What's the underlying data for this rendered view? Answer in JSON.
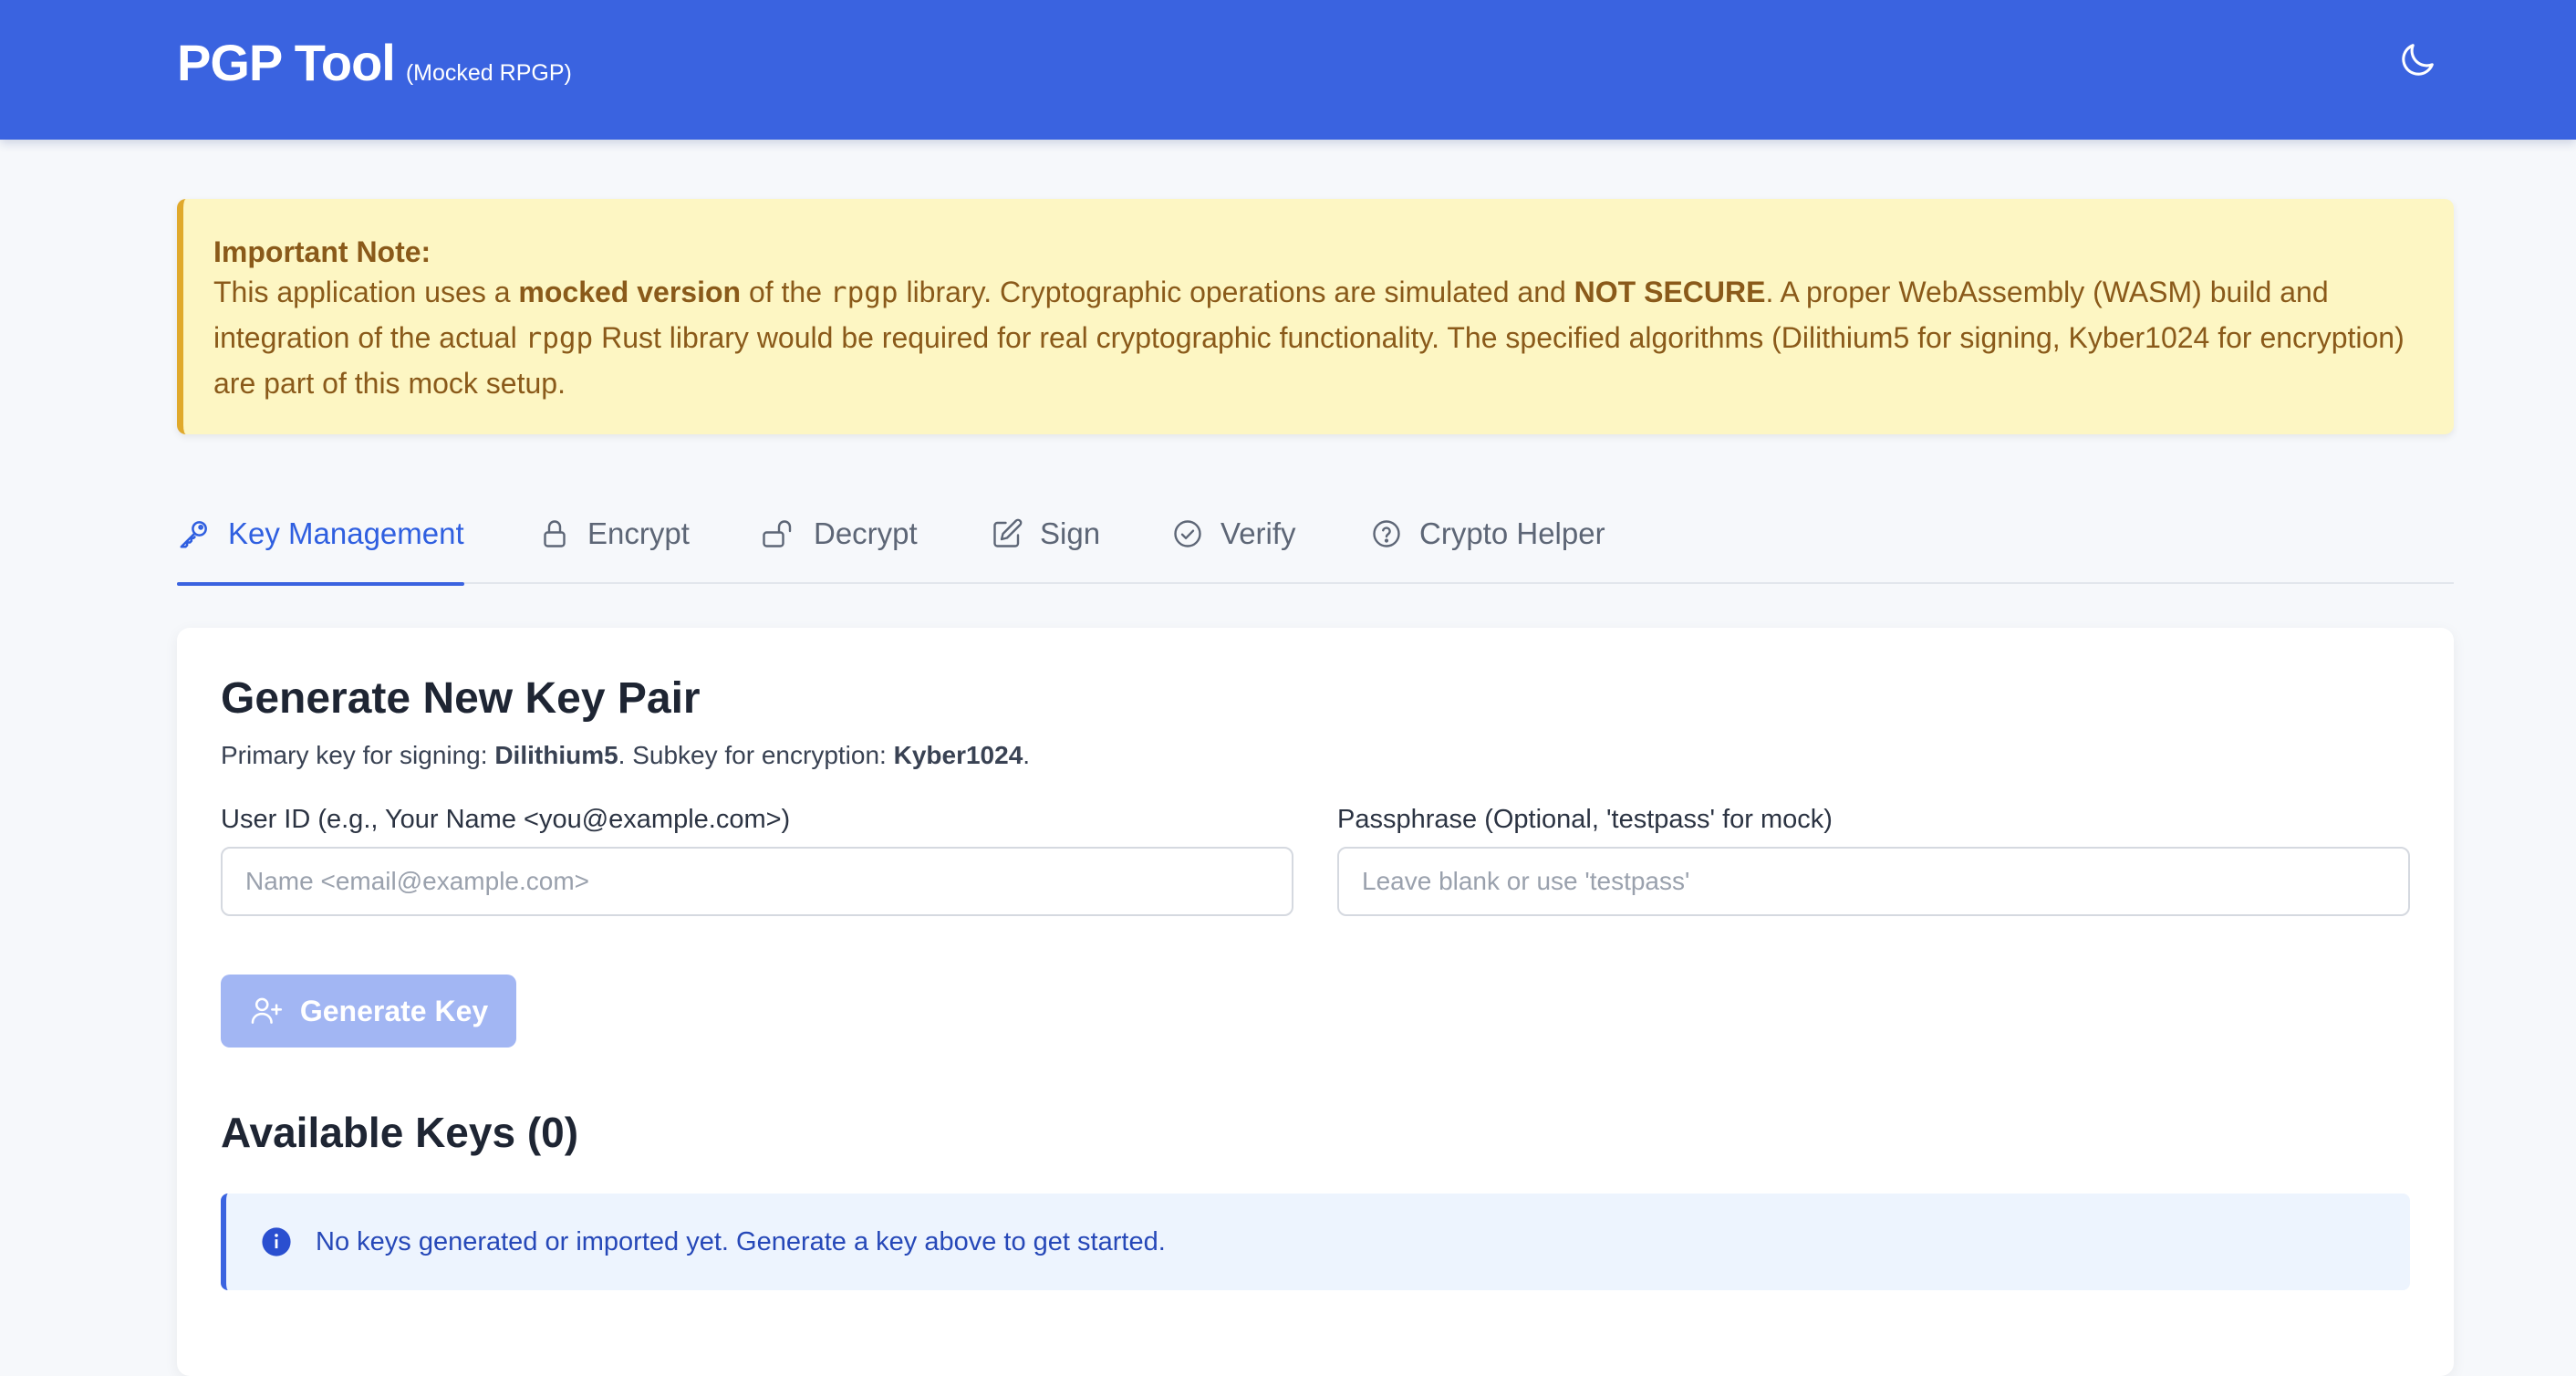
{
  "header": {
    "title": "PGP Tool",
    "subtitle": "(Mocked RPGP)",
    "theme_icon": "moon-icon",
    "color": "#3a63e0"
  },
  "note": {
    "title": "Important Note:",
    "line1_a": "This application uses a ",
    "line1_bold": "mocked version",
    "line1_b": " of the ",
    "line1_code": "rpgp",
    "line1_c": " library. Cryptographic operations are simulated and ",
    "line1_bold2": "NOT SECURE",
    "line1_d": ". A proper WebAssembly (WASM) build and integration of the actual ",
    "line1_code2": "rpgp",
    "line1_e": " Rust library would be required for real cryptographic functionality. The specified algorithms (Dilithium5 for signing, Kyber1024 for encryption) are part of this mock setup."
  },
  "tabs": [
    {
      "label": "Key Management",
      "icon": "key-icon",
      "active": true
    },
    {
      "label": "Encrypt",
      "icon": "lock-icon",
      "active": false
    },
    {
      "label": "Decrypt",
      "icon": "unlock-icon",
      "active": false
    },
    {
      "label": "Sign",
      "icon": "pencil-square-icon",
      "active": false
    },
    {
      "label": "Verify",
      "icon": "check-circle-icon",
      "active": false
    },
    {
      "label": "Crypto Helper",
      "icon": "question-circle-icon",
      "active": false
    }
  ],
  "generate": {
    "heading": "Generate New Key Pair",
    "desc_a": "Primary key for signing: ",
    "desc_alg1": "Dilithium5",
    "desc_b": ". Subkey for encryption: ",
    "desc_alg2": "Kyber1024",
    "desc_c": ".",
    "user_id_label": "User ID (e.g., Your Name <you@example.com>)",
    "user_id_placeholder": "Name <email@example.com>",
    "user_id_value": "",
    "passphrase_label": "Passphrase (Optional, 'testpass' for mock)",
    "passphrase_placeholder": "Leave blank or use 'testpass'",
    "passphrase_value": "",
    "button_label": "Generate Key",
    "button_icon": "user-plus-icon"
  },
  "available": {
    "heading": "Available Keys (0)",
    "empty_message": "No keys generated or imported yet. Generate a key above to get started.",
    "info_icon": "info-icon"
  }
}
